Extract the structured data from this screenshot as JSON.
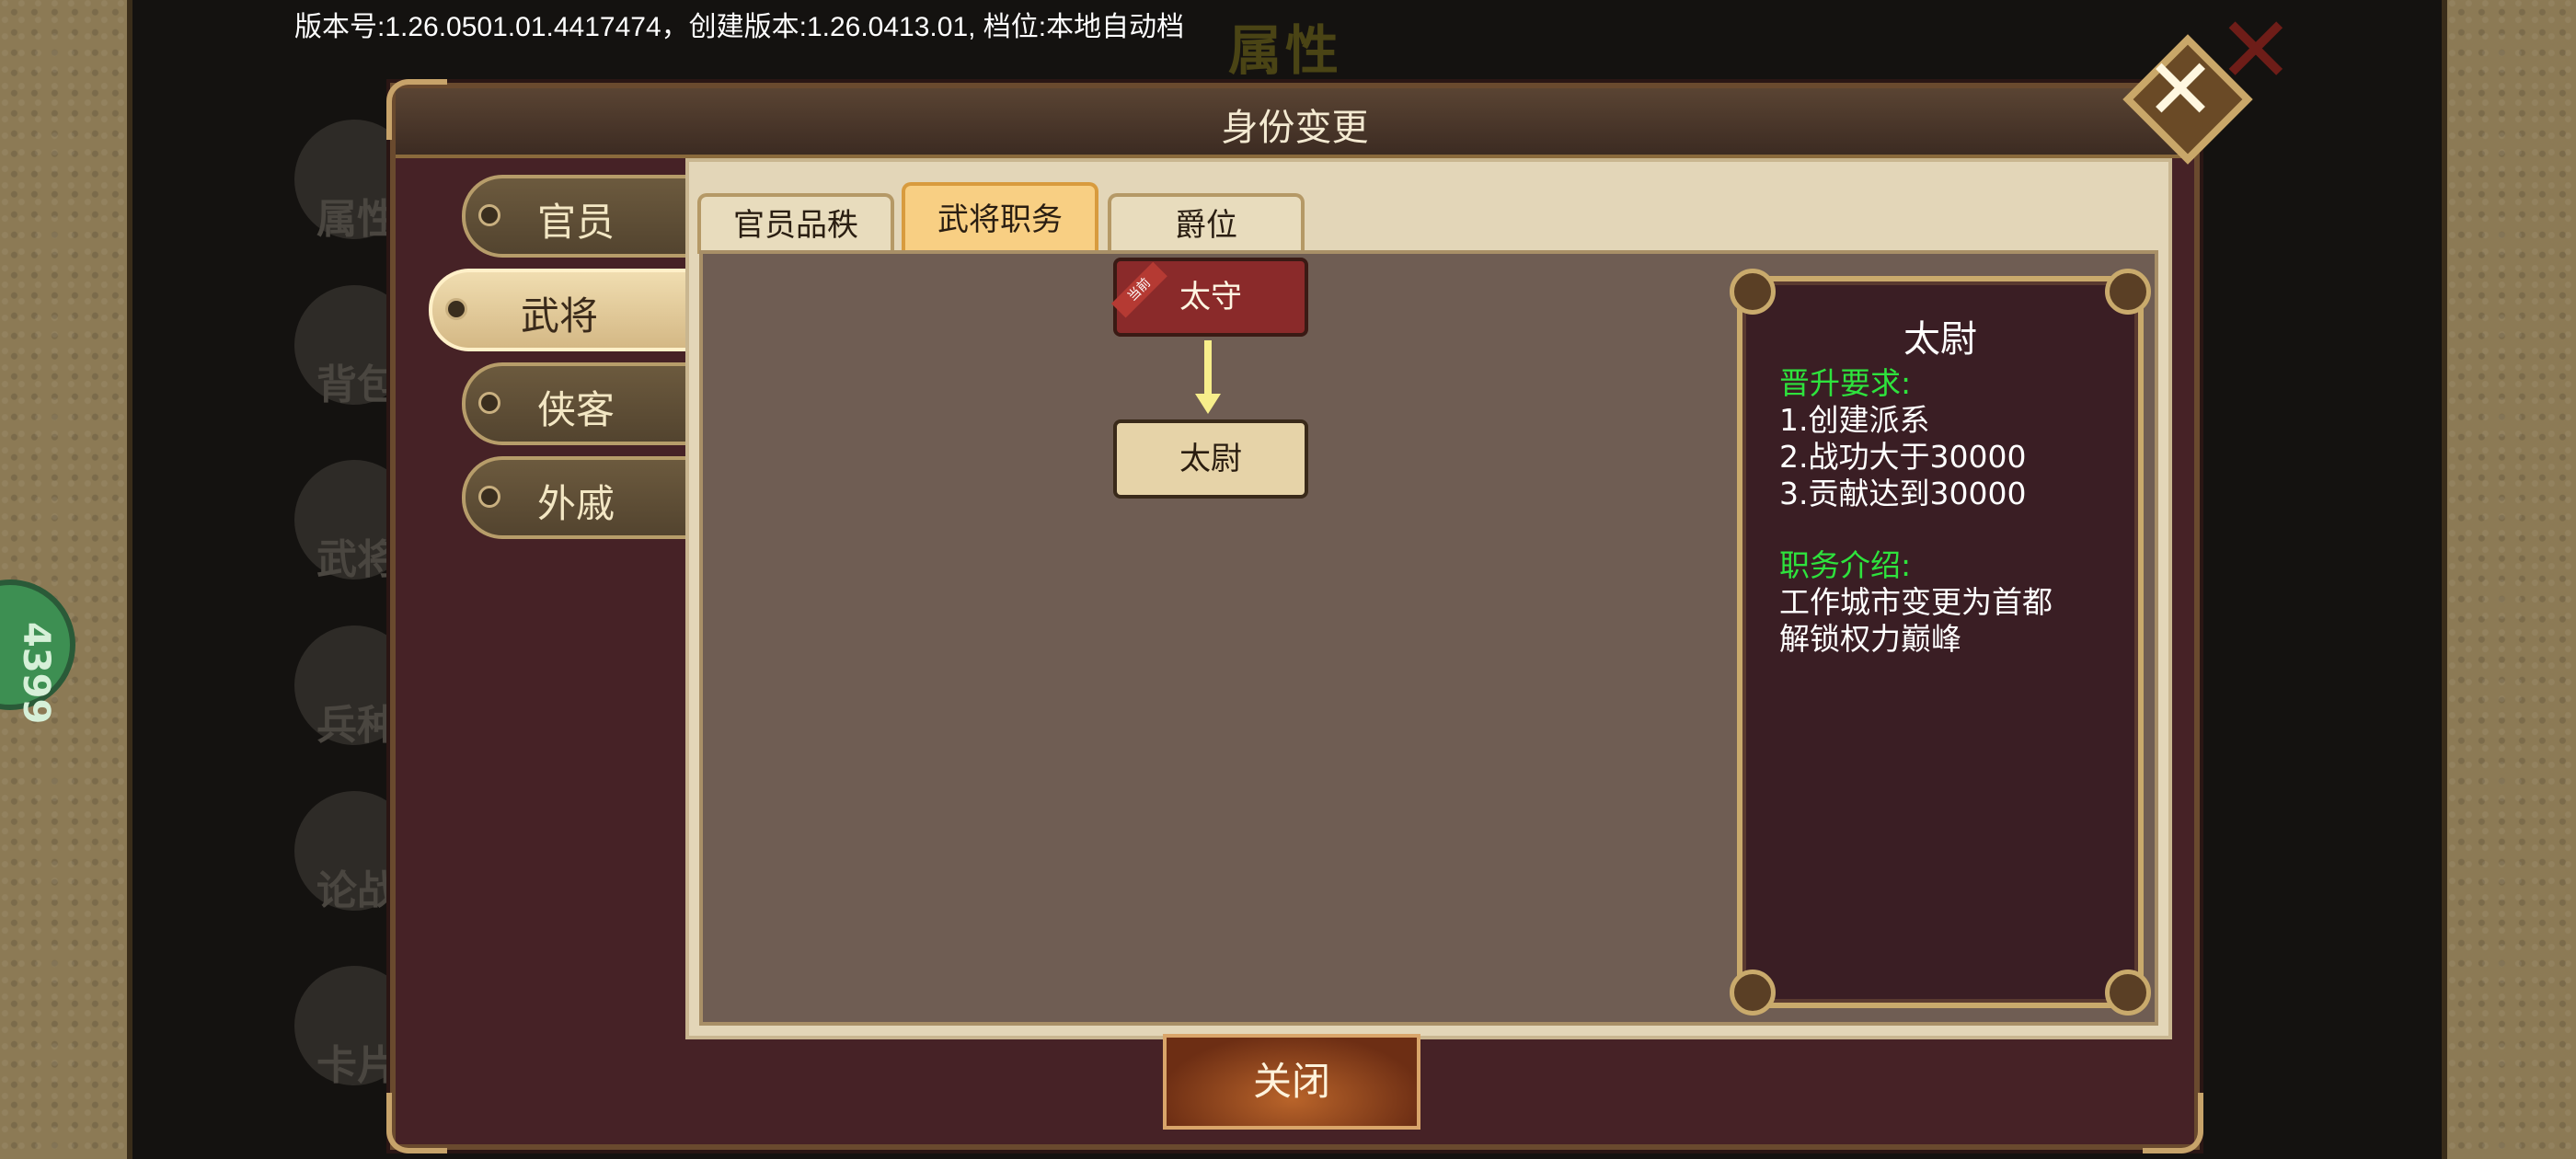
{
  "version_text": "版本号:1.26.0501.01.4417474，创建版本:1.26.0413.01, 档位:本地自动档",
  "background": {
    "title": "属性",
    "menu": [
      "属性",
      "背包",
      "武将",
      "兵种",
      "论战",
      "卡片"
    ],
    "badge": "4399"
  },
  "dialog": {
    "title": "身份变更",
    "side_tabs": [
      {
        "label": "官员",
        "active": false
      },
      {
        "label": "武将",
        "active": true
      },
      {
        "label": "侠客",
        "active": false
      },
      {
        "label": "外戚",
        "active": false
      }
    ],
    "tabs": [
      {
        "label": "官员品秩",
        "active": false
      },
      {
        "label": "武将职务",
        "active": true
      },
      {
        "label": "爵位",
        "active": false
      }
    ],
    "tree": {
      "current_node": "太守",
      "current_ribbon": "当前",
      "next_node": "太尉"
    },
    "info": {
      "title": "太尉",
      "req_header": "晋升要求:",
      "requirements": [
        "1.创建派系",
        "2.战功大于30000",
        "3.贡献达到30000"
      ],
      "desc_header": "职务介绍:",
      "description": [
        "工作城市变更为首都",
        "解锁权力巅峰"
      ]
    },
    "close_button": "关闭"
  },
  "colors": {
    "dialog_bg": "#462226",
    "accent_gold": "#c9aa6c",
    "highlight_green": "#2ee33d",
    "active_tab": "#f8cf83"
  }
}
